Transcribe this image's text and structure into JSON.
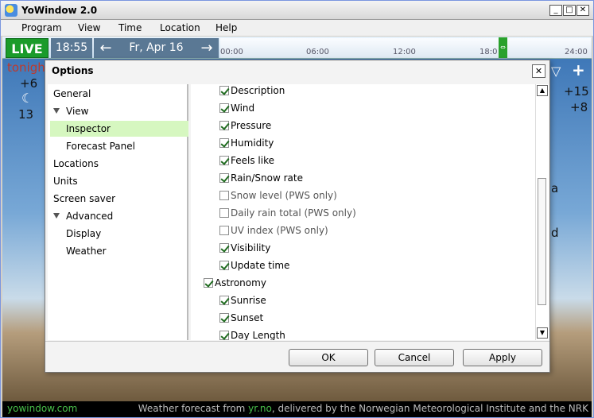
{
  "window": {
    "title": "YoWindow 2.0"
  },
  "menu": [
    "Program",
    "View",
    "Time",
    "Location",
    "Help"
  ],
  "timebar": {
    "live_label": "LIVE",
    "current_time": "18:55",
    "date": "Fr, Apr 16",
    "ticks": [
      "00:00",
      "06:00",
      "12:00",
      "18:0",
      "24:00"
    ]
  },
  "scene": {
    "tonight_label": "tonight",
    "temp_high": "+6",
    "temp_low": "13",
    "temp_right_1": "+15",
    "temp_right_2": "+8",
    "partial_1": "a",
    "partial_2": "d"
  },
  "bottom": {
    "site_link": "yowindow.com",
    "credit_prefix": "Weather forecast from ",
    "credit_link": "yr.no",
    "credit_suffix": ", delivered by the Norwegian Meteorological Institute and the NRK"
  },
  "dialog": {
    "title": "Options",
    "tree": [
      {
        "label": "General",
        "indent": 0,
        "expanded": false,
        "selected": false
      },
      {
        "label": "View",
        "indent": 0,
        "expanded": true,
        "selected": false
      },
      {
        "label": "Inspector",
        "indent": 1,
        "expanded": false,
        "selected": true
      },
      {
        "label": "Forecast Panel",
        "indent": 1,
        "expanded": false,
        "selected": false
      },
      {
        "label": "Locations",
        "indent": 0,
        "expanded": false,
        "selected": false
      },
      {
        "label": "Units",
        "indent": 0,
        "expanded": false,
        "selected": false
      },
      {
        "label": "Screen saver",
        "indent": 0,
        "expanded": false,
        "selected": false
      },
      {
        "label": "Advanced",
        "indent": 0,
        "expanded": true,
        "selected": false
      },
      {
        "label": "Display",
        "indent": 1,
        "expanded": false,
        "selected": false
      },
      {
        "label": "Weather",
        "indent": 1,
        "expanded": false,
        "selected": false
      }
    ],
    "options": [
      {
        "label": "Description",
        "checked": true,
        "level": 1
      },
      {
        "label": "Wind",
        "checked": true,
        "level": 1
      },
      {
        "label": "Pressure",
        "checked": true,
        "level": 1
      },
      {
        "label": "Humidity",
        "checked": true,
        "level": 1
      },
      {
        "label": "Feels like",
        "checked": true,
        "level": 1
      },
      {
        "label": "Rain/Snow rate",
        "checked": true,
        "level": 1
      },
      {
        "label": "Snow level (PWS only)",
        "checked": false,
        "level": 1
      },
      {
        "label": "Daily rain total (PWS only)",
        "checked": false,
        "level": 1
      },
      {
        "label": "UV index (PWS only)",
        "checked": false,
        "level": 1
      },
      {
        "label": "Visibility",
        "checked": true,
        "level": 1
      },
      {
        "label": "Update time",
        "checked": true,
        "level": 1
      },
      {
        "label": "Astronomy",
        "checked": true,
        "level": 0
      },
      {
        "label": "Sunrise",
        "checked": true,
        "level": 1
      },
      {
        "label": "Sunset",
        "checked": true,
        "level": 1
      },
      {
        "label": "Day Length",
        "checked": true,
        "level": 1
      }
    ],
    "buttons": {
      "ok": "OK",
      "cancel": "Cancel",
      "apply": "Apply"
    }
  },
  "icons": [
    "app-icon",
    "minimize-icon",
    "maximize-icon",
    "close-icon",
    "arrow-left-icon",
    "arrow-right-icon",
    "moon-cloud-icon",
    "scroll-up-icon",
    "scroll-down-icon"
  ]
}
